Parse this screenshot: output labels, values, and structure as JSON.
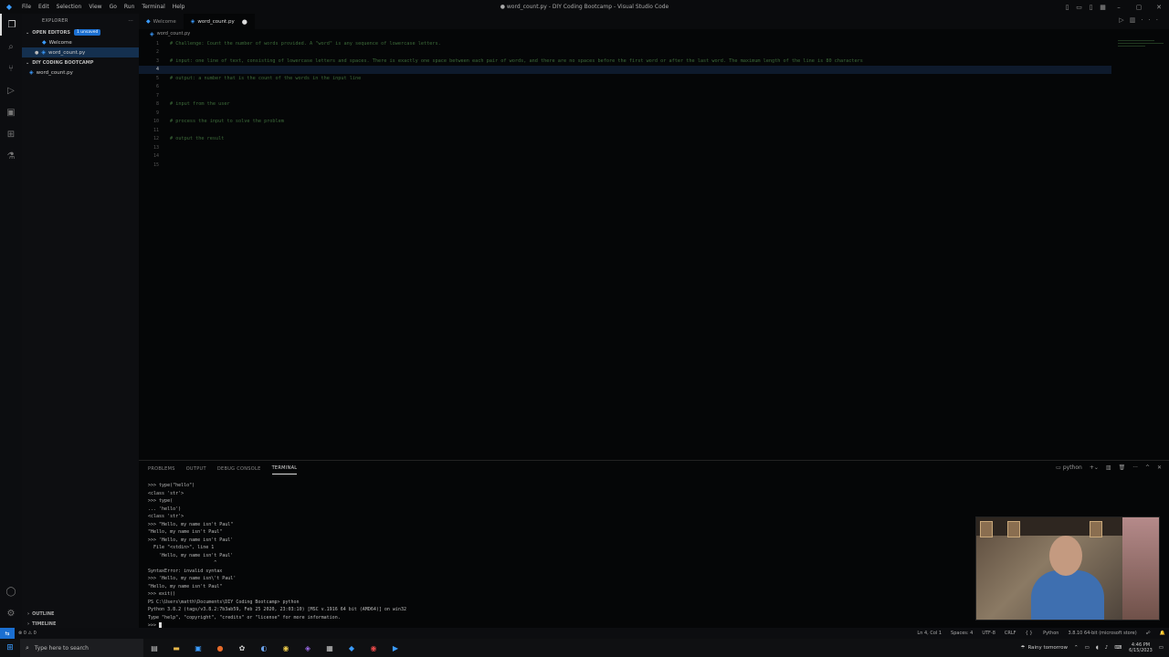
{
  "window": {
    "title": "● word_count.py - DIY Coding Bootcamp - Visual Studio Code",
    "menu": [
      "File",
      "Edit",
      "Selection",
      "View",
      "Go",
      "Run",
      "Terminal",
      "Help"
    ]
  },
  "sidebar": {
    "header": "EXPLORER",
    "open_editors_label": "OPEN EDITORS",
    "unsaved_badge": "1 unsaved",
    "open_editors": [
      "Welcome",
      "word_count.py"
    ],
    "folder_label": "DIY CODING BOOTCAMP",
    "files": [
      "word_count.py"
    ],
    "outline_label": "OUTLINE",
    "timeline_label": "TIMELINE"
  },
  "tabs": [
    {
      "label": "Welcome"
    },
    {
      "label": "word_count.py"
    }
  ],
  "breadcrumb": "word_count.py",
  "editor": {
    "lines": [
      {
        "n": "1",
        "text": "# Challenge: Count the number of words provided. A \"word\" is any sequence of lowercase letters."
      },
      {
        "n": "2",
        "text": ""
      },
      {
        "n": "3",
        "text": "# input: one line of text, consisting of lowercase letters and spaces. There is exactly one space between each pair of words, and there are no spaces before the first word or after the last word. The maximum length of the line is 80 characters"
      },
      {
        "n": "4",
        "text": ""
      },
      {
        "n": "5",
        "text": "# output: a number that is the count of the words in the input line"
      },
      {
        "n": "6",
        "text": ""
      },
      {
        "n": "7",
        "text": ""
      },
      {
        "n": "8",
        "text": "# input from the user"
      },
      {
        "n": "9",
        "text": ""
      },
      {
        "n": "10",
        "text": "# process the input to solve the problem"
      },
      {
        "n": "11",
        "text": ""
      },
      {
        "n": "12",
        "text": "# output the result"
      },
      {
        "n": "13",
        "text": ""
      },
      {
        "n": "14",
        "text": ""
      },
      {
        "n": "15",
        "text": ""
      }
    ]
  },
  "panel": {
    "tabs": [
      "PROBLEMS",
      "OUTPUT",
      "DEBUG CONSOLE",
      "TERMINAL"
    ],
    "shell_label": "python",
    "terminal_lines": [
      ">>> type(\"hello\")",
      "<class 'str'>",
      ">>> type(",
      "... 'hello')",
      "<class 'str'>",
      ">>> \"Hello, my name isn't Paul\"",
      "\"Hello, my name isn't Paul\"",
      ">>> 'Hello, my name isn't Paul'",
      "  File \"<stdin>\", line 1",
      "    'Hello, my name isn't Paul'",
      "                        ^",
      "SyntaxError: invalid syntax",
      ">>> 'Hello, my name isn\\'t Paul'",
      "\"Hello, my name isn't Paul\"",
      ">>> exit()",
      "PS C:\\Users\\matth\\Documents\\DIY Coding Bootcamp> python",
      "Python 3.8.2 (tags/v3.8.2:7b3ab59, Feb 25 2020, 23:03:10) [MSC v.1916 64 bit (AMD64)] on win32",
      "Type \"help\", \"copyright\", \"credits\" or \"license\" for more information.",
      ">>> "
    ]
  },
  "statusbar": {
    "errors": "⊗ 0 ⚠ 0",
    "position": "Ln 4, Col 1",
    "spaces": "Spaces: 4",
    "encoding": "UTF-8",
    "eol": "CRLF",
    "language": "Python",
    "interpreter": "3.8.10 64-bit (microsoft store)"
  },
  "taskbar": {
    "search_placeholder": "Type here to search",
    "weather": "Rainy tomorrow",
    "time": "4:46 PM",
    "date": "6/15/2023"
  },
  "colors": {
    "accent": "#1b6fd1",
    "comment": "#3d6b3a",
    "background": "#050607"
  }
}
